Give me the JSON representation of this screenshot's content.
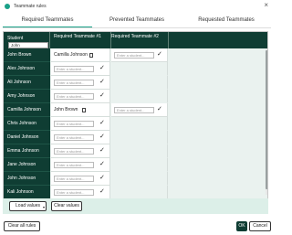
{
  "window": {
    "title": "Teammate rules",
    "close_icon": "close-icon"
  },
  "tabs": [
    {
      "label": "Required Teammates",
      "active": true
    },
    {
      "label": "Prevented Teammates",
      "active": false
    },
    {
      "label": "Requested Teammates",
      "active": false
    }
  ],
  "grid": {
    "student_header": "Student",
    "search_value": "John",
    "col1_header": "Required Teammate #1",
    "col2_header": "Required Teammate #2",
    "input_placeholder": "Enter a student...",
    "rows": [
      {
        "name": "John Brown",
        "t1": "Camilla Johnson",
        "t1_filled": true,
        "show_t2": true,
        "t2": "",
        "t2_filled": false
      },
      {
        "name": "Alex Johnson",
        "t1": "",
        "t1_filled": false,
        "show_t2": false
      },
      {
        "name": "Ali Johnson",
        "t1": "",
        "t1_filled": false,
        "show_t2": false
      },
      {
        "name": "Amy Johnson",
        "t1": "",
        "t1_filled": false,
        "show_t2": false
      },
      {
        "name": "Camilla Johnson",
        "t1": "John Brown",
        "t1_filled": true,
        "show_t2": true,
        "t2": "",
        "t2_filled": false
      },
      {
        "name": "Chris Johnson",
        "t1": "",
        "t1_filled": false,
        "show_t2": false
      },
      {
        "name": "Daniel Johnson",
        "t1": "",
        "t1_filled": false,
        "show_t2": false
      },
      {
        "name": "Emma Johnson",
        "t1": "",
        "t1_filled": false,
        "show_t2": false
      },
      {
        "name": "Jane Johnson",
        "t1": "",
        "t1_filled": false,
        "show_t2": false
      },
      {
        "name": "John Johnson",
        "t1": "",
        "t1_filled": false,
        "show_t2": false
      },
      {
        "name": "Kali Johnson",
        "t1": "",
        "t1_filled": false,
        "show_t2": false
      }
    ]
  },
  "buttons": {
    "load_values": "Load values",
    "clear_values": "Clear values",
    "clear_all_rules": "Clear all rules",
    "ok": "OK",
    "cancel": "Cancel"
  },
  "colors": {
    "accent": "#1aa188",
    "dark_green": "#0f3d33",
    "panel_bg": "#dcefe8"
  }
}
